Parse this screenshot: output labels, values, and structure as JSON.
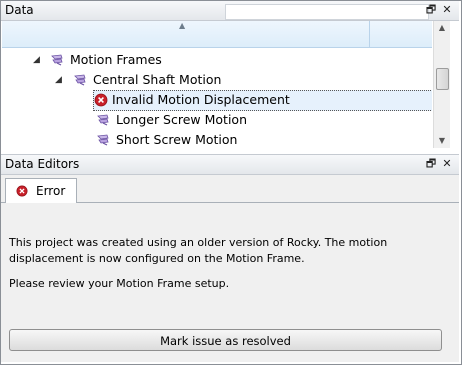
{
  "data_panel": {
    "title": "Data",
    "window_buttons": {
      "float": "🗗",
      "close": "✕"
    },
    "search": {
      "value": ""
    },
    "tree": {
      "sort_indicator": "▲",
      "rows": [
        {
          "label": "Motion Frames",
          "icon": "motion-frame-icon",
          "expander": "◢"
        },
        {
          "label": "Central Shaft Motion",
          "icon": "motion-frame-icon",
          "expander": "◢"
        },
        {
          "label": "Invalid Motion Displacement",
          "icon": "error-icon",
          "selected": true
        },
        {
          "label": "Longer Screw Motion",
          "icon": "motion-frame-icon"
        },
        {
          "label": "Short Screw Motion",
          "icon": "motion-frame-icon"
        }
      ]
    },
    "scrollbar": {
      "up": "▲",
      "down": "▼"
    }
  },
  "editors_panel": {
    "title": "Data Editors",
    "window_buttons": {
      "float": "🗗",
      "close": "✕"
    },
    "tab": {
      "label": "Error",
      "icon": "error-icon"
    },
    "message": {
      "line1": "This project was created using an older version of Rocky. The motion displacement is now configured on the Motion Frame.",
      "line2": "Please review your Motion Frame setup."
    },
    "resolve_button": "Mark issue as resolved"
  },
  "colors": {
    "error": "#c8202a",
    "selection": "#e6f1fc",
    "header_strip": "#ddedfa"
  }
}
